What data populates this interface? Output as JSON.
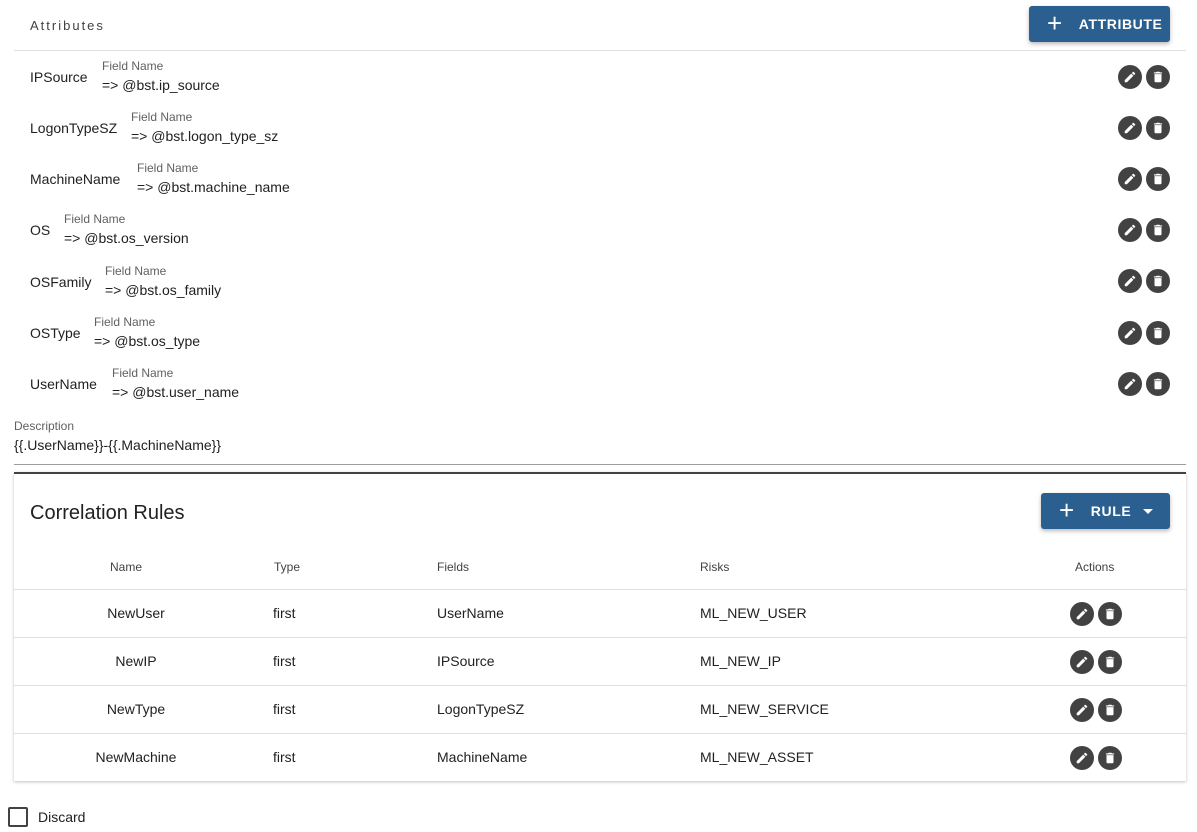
{
  "attributes_section": {
    "title": "Attributes",
    "add_button_label": "ATTRIBUTE",
    "field_label": "Field Name",
    "items": [
      {
        "name": "IPSource",
        "field": "=> @bst.ip_source"
      },
      {
        "name": "LogonTypeSZ",
        "field": "=> @bst.logon_type_sz"
      },
      {
        "name": "MachineName",
        "field": "=> @bst.machine_name"
      },
      {
        "name": "OS",
        "field": "=> @bst.os_version"
      },
      {
        "name": "OSFamily",
        "field": "=> @bst.os_family"
      },
      {
        "name": "OSType",
        "field": "=> @bst.os_type"
      },
      {
        "name": "UserName",
        "field": "=> @bst.user_name"
      }
    ]
  },
  "description": {
    "label": "Description",
    "value": "{{.UserName}}-{{.MachineName}}"
  },
  "correlation_rules": {
    "title": "Correlation Rules",
    "add_button_label": "RULE",
    "columns": [
      "Name",
      "Type",
      "Fields",
      "Risks",
      "Actions"
    ],
    "rows": [
      {
        "name": "NewUser",
        "type": "first",
        "fields": "UserName",
        "risks": "ML_NEW_USER"
      },
      {
        "name": "NewIP",
        "type": "first",
        "fields": "IPSource",
        "risks": "ML_NEW_IP"
      },
      {
        "name": "NewType",
        "type": "first",
        "fields": "LogonTypeSZ",
        "risks": "ML_NEW_SERVICE"
      },
      {
        "name": "NewMachine",
        "type": "first",
        "fields": "MachineName",
        "risks": "ML_NEW_ASSET"
      }
    ]
  },
  "discard": {
    "label": "Discard",
    "checked": false
  },
  "icons": {
    "add": "plus-icon",
    "edit": "pencil-icon",
    "delete": "trash-icon",
    "dropdown": "chevron-down-icon"
  },
  "colors": {
    "primary": "#2a5f8f",
    "icon_bg": "#424242"
  }
}
